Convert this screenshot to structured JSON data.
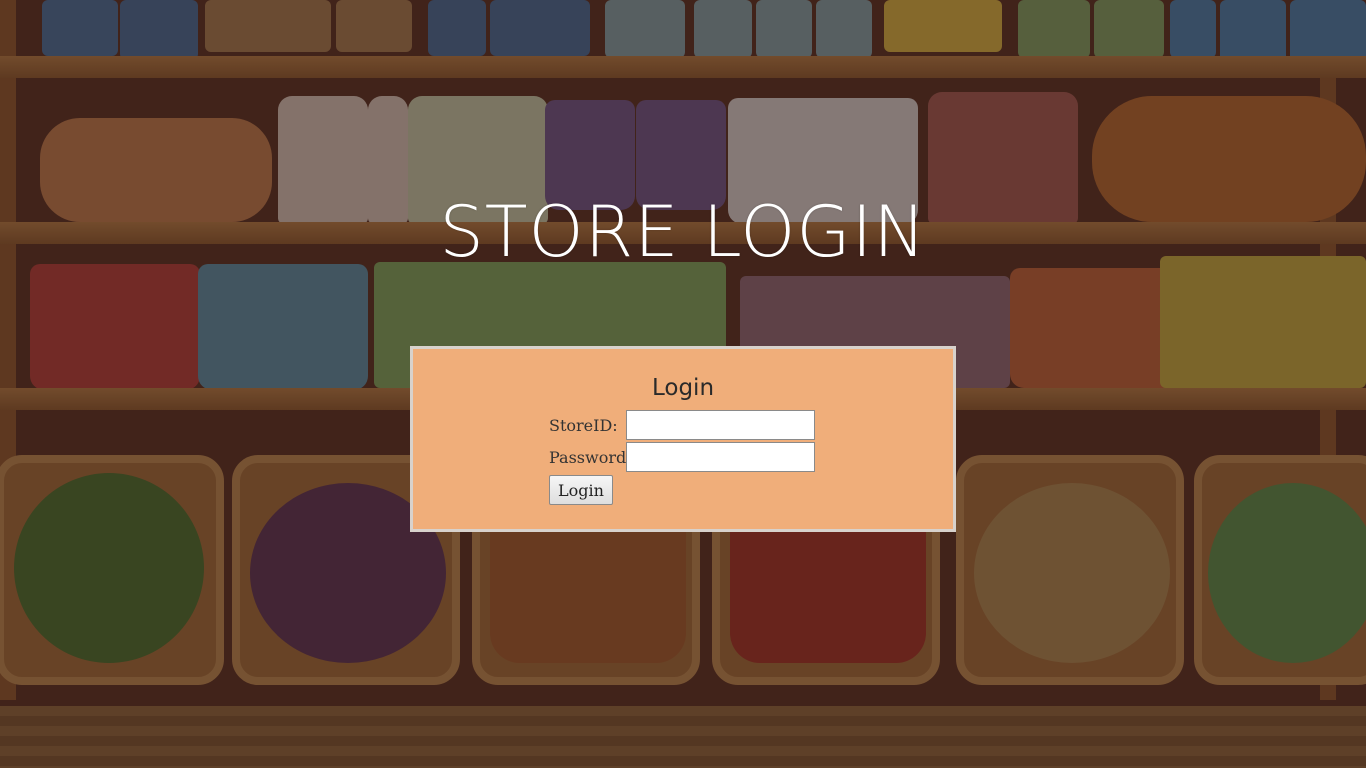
{
  "page": {
    "title": "STORE LOGIN"
  },
  "login_form": {
    "heading": "Login",
    "store_id_label": "StoreID:",
    "store_id_value": "",
    "password_label": "Password:",
    "password_value": "",
    "submit_label": "Login"
  },
  "colors": {
    "panel_background": "#f0ae7a",
    "title_text": "#ffffff"
  }
}
